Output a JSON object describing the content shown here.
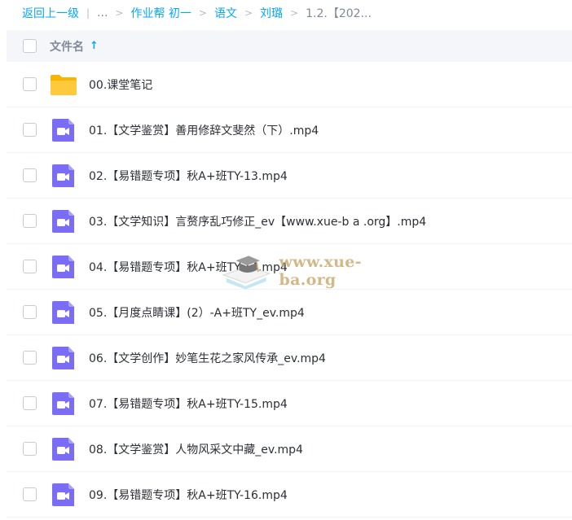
{
  "breadcrumb": {
    "back": "返回上一级",
    "ellipsis": "...",
    "items": [
      "作业帮 初一",
      "语文",
      "刘璐"
    ],
    "current": "1.2.【202..."
  },
  "header": {
    "column_filename": "文件名",
    "sort_icon": "arrow-up-icon"
  },
  "files": [
    {
      "name": "00.课堂笔记",
      "type": "folder"
    },
    {
      "name": "01.【文学鉴赏】善用修辞文斐然（下）.mp4",
      "type": "video"
    },
    {
      "name": "02.【易错题专项】秋A+班TY-13.mp4",
      "type": "video"
    },
    {
      "name": "03.【文学知识】言赘序乱巧修正_ev【www.xue-b a .org】.mp4",
      "type": "video"
    },
    {
      "name": "04.【易错题专项】秋A+班TY-14.mp4",
      "type": "video"
    },
    {
      "name": "05.【月度点睛课】(2）-A+班TY_ev.mp4",
      "type": "video"
    },
    {
      "name": "06.【文学创作】妙笔生花之家风传承_ev.mp4",
      "type": "video"
    },
    {
      "name": "07.【易错题专项】秋A+班TY-15.mp4",
      "type": "video"
    },
    {
      "name": "08.【文学鉴赏】人物风采文中藏_ev.mp4",
      "type": "video"
    },
    {
      "name": "09.【易错题专项】秋A+班TY-16.mp4",
      "type": "video"
    }
  ],
  "watermark": {
    "text": "www.xue-ba.org",
    "icon": "graduation-cap-icon"
  },
  "colors": {
    "accent": "#06a7ff",
    "video_icon": "#7b6cf6",
    "folder": "#ffc93c"
  }
}
